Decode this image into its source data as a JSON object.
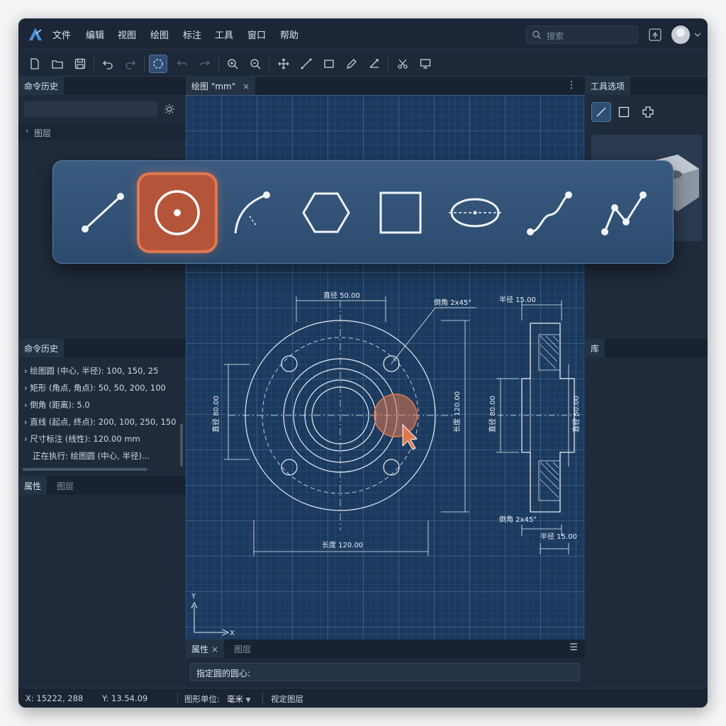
{
  "menu": {
    "items": [
      "文件",
      "编辑",
      "视图",
      "绘图",
      "标注",
      "工具",
      "窗口",
      "帮助"
    ],
    "active_index": 3
  },
  "search": {
    "placeholder": "搜索"
  },
  "toolbar": {
    "icons": [
      "new-file-icon",
      "open-folder-icon",
      "save-icon",
      "undo-icon",
      "redo-icon",
      "circle-tool-icon",
      "undo-arc-icon",
      "redo-arc-icon",
      "zoom-in-icon",
      "zoom-out-icon",
      "move-icon",
      "line-icon",
      "rectangle-icon",
      "pencil-icon",
      "dimension-icon",
      "trim-icon",
      "screen-icon"
    ],
    "active": "circle-tool-icon"
  },
  "left_panel": {
    "top_tab": "命令历史",
    "layers_label": "图层",
    "history_tab": "命令历史",
    "history": [
      "绘图圆 (中心, 半径): 100, 150, 25",
      "矩形 (角点, 角点): 50, 50, 200, 100",
      "倒角 (距离): 5.0",
      "直线 (起点, 终点): 200, 100, 250, 150",
      "尺寸标注 (线性): 120.00 mm",
      "正在执行: 绘图圆 (中心, 半径)..."
    ],
    "bottom_tabs": [
      "属性",
      "图层"
    ]
  },
  "drawing": {
    "tab_title": "绘图 \"mm\"",
    "dims": {
      "diameter_top": "直径 50.00",
      "chamfer_top": "倒角 2x45°",
      "half_top": "半径 15.00",
      "left_vertical": "直径 80.00",
      "length_vertical": "长度 120.00",
      "side_left_vertical": "直径 80.00",
      "side_right_vertical": "直径 50.00",
      "chamfer_bottom": "倒角 2x45°",
      "length_bottom": "长度 120.00",
      "half_bottom": "半径 15.00"
    },
    "axis_x": "X",
    "axis_y": "Y",
    "bottom_tabs": [
      "属性",
      "图层"
    ],
    "command_prompt": "指定圆的圆心:"
  },
  "right_panel": {
    "tool_tab": "工具选项",
    "library_tab": "库"
  },
  "palette": {
    "tools": [
      "line-tool-icon",
      "circle-tool-icon",
      "arc-tool-icon",
      "polygon-tool-icon",
      "rectangle-tool-icon",
      "ellipse-tool-icon",
      "spline-tool-icon",
      "polyline-tool-icon"
    ],
    "selected": "circle-tool-icon"
  },
  "status": {
    "x": "X: 15222, 288",
    "y": "Y: 13.54.09",
    "unit_label": "图形单位:",
    "unit_value": "毫米",
    "snap": "视定图层"
  },
  "colors": {
    "accent": "#e0784f",
    "canvas": "#1b3a5e",
    "chrome": "#1f2a3a"
  }
}
